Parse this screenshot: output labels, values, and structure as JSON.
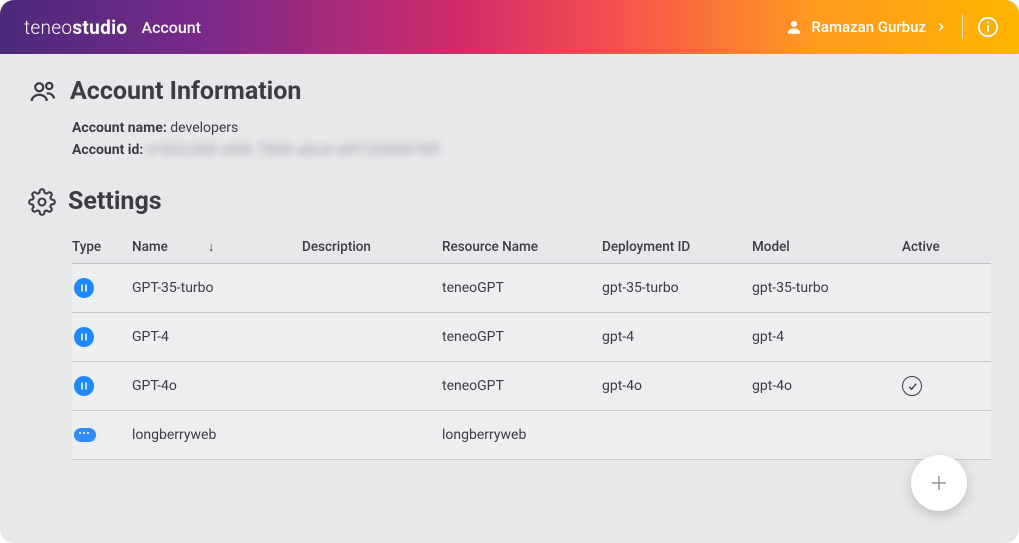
{
  "header": {
    "brand_thin": "teneo",
    "brand_bold": "studio",
    "sublabel": "Account",
    "user_name": "Ramazan Gurbuz"
  },
  "account_info": {
    "section_title": "Account Information",
    "name_label": "Account name:",
    "name_value": "developers",
    "id_label": "Account id:",
    "id_value": "a1b2c3d4 e5f6 7890 abcd ef0123456789"
  },
  "settings": {
    "section_title": "Settings",
    "columns": {
      "type": "Type",
      "name": "Name",
      "description": "Description",
      "resource_name": "Resource Name",
      "deployment_id": "Deployment ID",
      "model": "Model",
      "active": "Active"
    },
    "rows": [
      {
        "type": "openai",
        "name": "GPT-35-turbo",
        "description": "",
        "resource_name": "teneoGPT",
        "deployment_id": "gpt-35-turbo",
        "model": "gpt-35-turbo",
        "active": false
      },
      {
        "type": "openai",
        "name": "GPT-4",
        "description": "",
        "resource_name": "teneoGPT",
        "deployment_id": "gpt-4",
        "model": "gpt-4",
        "active": false
      },
      {
        "type": "openai",
        "name": "GPT-4o",
        "description": "",
        "resource_name": "teneoGPT",
        "deployment_id": "gpt-4o",
        "model": "gpt-4o",
        "active": true
      },
      {
        "type": "cloud",
        "name": "longberryweb",
        "description": "",
        "resource_name": "longberryweb",
        "deployment_id": "",
        "model": "",
        "active": false
      }
    ]
  }
}
